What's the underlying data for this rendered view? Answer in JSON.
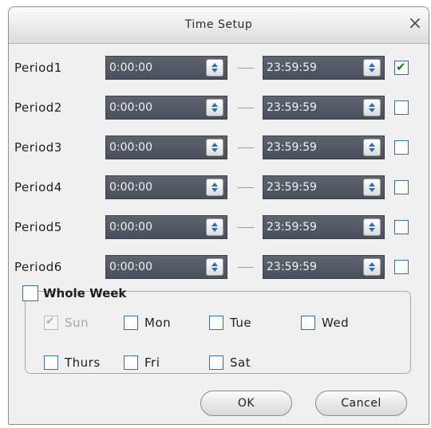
{
  "dialog": {
    "title": "Time Setup",
    "close_glyph": "×"
  },
  "periods": [
    {
      "label": "Period1",
      "start": "0:00:00",
      "end": "23:59:59",
      "checked": true
    },
    {
      "label": "Period2",
      "start": "0:00:00",
      "end": "23:59:59",
      "checked": false
    },
    {
      "label": "Period3",
      "start": "0:00:00",
      "end": "23:59:59",
      "checked": false
    },
    {
      "label": "Period4",
      "start": "0:00:00",
      "end": "23:59:59",
      "checked": false
    },
    {
      "label": "Period5",
      "start": "0:00:00",
      "end": "23:59:59",
      "checked": false
    },
    {
      "label": "Period6",
      "start": "0:00:00",
      "end": "23:59:59",
      "checked": false
    }
  ],
  "week": {
    "label": "Whole Week",
    "checked": false,
    "days": [
      {
        "label": "Sun",
        "checked": true,
        "disabled": true
      },
      {
        "label": "Mon",
        "checked": false,
        "disabled": false
      },
      {
        "label": "Tue",
        "checked": false,
        "disabled": false
      },
      {
        "label": "Wed",
        "checked": false,
        "disabled": false
      },
      {
        "label": "Thurs",
        "checked": false,
        "disabled": false
      },
      {
        "label": "Fri",
        "checked": false,
        "disabled": false
      },
      {
        "label": "Sat",
        "checked": false,
        "disabled": false
      }
    ]
  },
  "buttons": {
    "ok": "OK",
    "cancel": "Cancel"
  },
  "colors": {
    "time_box": "#4a505b",
    "check_accent": "#1b7a1b",
    "border_accent": "#3a6ea5"
  },
  "icons": {
    "check": "✔",
    "spin": "spin-up-down-icon"
  }
}
